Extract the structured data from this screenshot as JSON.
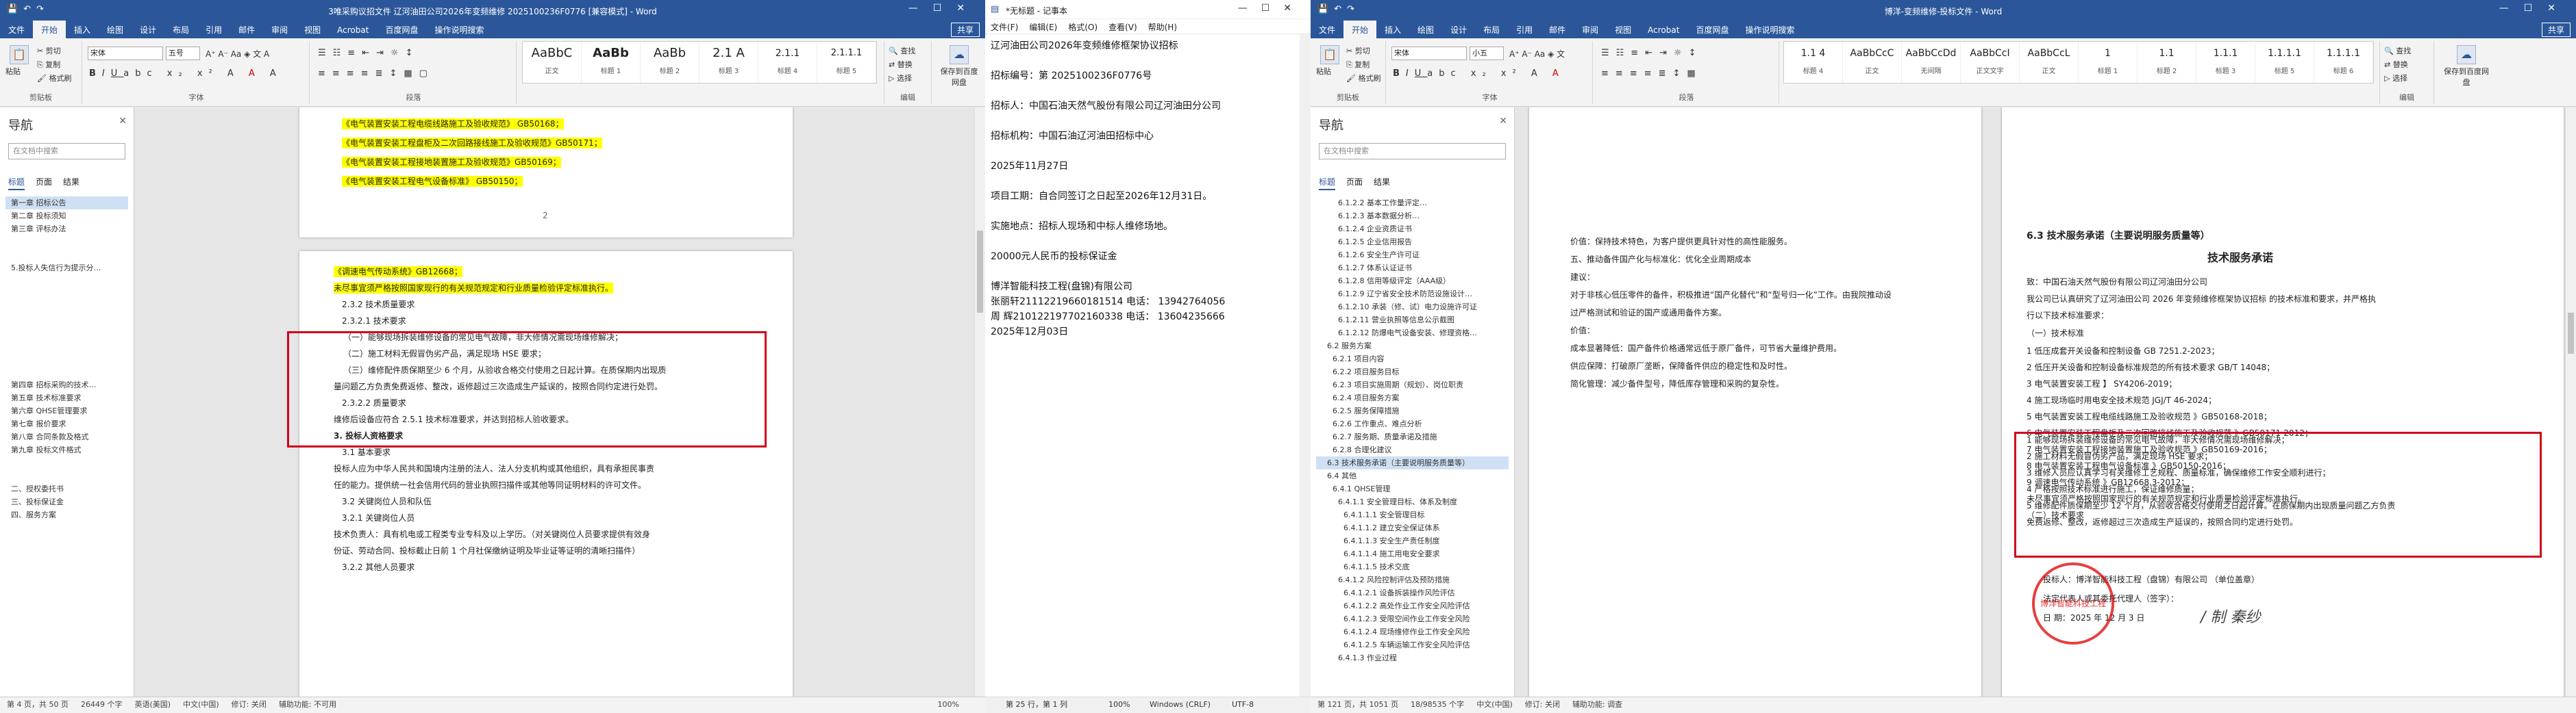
{
  "w1": {
    "title": "3唯采购议招文件 辽河油田公司2026年变频维修 2025100236F0776 [兼容模式] - Word",
    "tabs": [
      "文件",
      "开始",
      "插入",
      "绘图",
      "设计",
      "布局",
      "引用",
      "邮件",
      "审阅",
      "视图",
      "Acrobat",
      "百度网盘"
    ],
    "tell": "操作说明搜索",
    "share": "共享",
    "font": "宋体",
    "size": "五号",
    "groups": [
      "剪贴板",
      "字体",
      "段落",
      "样式",
      "编辑",
      "保存到百度网盘"
    ],
    "clip": [
      "粘贴",
      "剪切",
      "复制",
      "格式刷"
    ],
    "styles": [
      {
        "pv": "AaBbC",
        "nm": "正文"
      },
      {
        "pv": "AaBb",
        "nm": "标题 1"
      },
      {
        "pv": "AaBb",
        "nm": "标题 2"
      },
      {
        "pv": "2.1 A",
        "nm": "标题 3"
      },
      {
        "pv": "2.1.1",
        "nm": "标题 4"
      },
      {
        "pv": "2.1.1.1",
        "nm": "标题 5"
      }
    ],
    "edit": [
      "查找",
      "替换",
      "选择"
    ],
    "nav": {
      "title": "导航",
      "search": "在文档中搜索",
      "tabs": [
        "标题",
        "页面",
        "结果"
      ],
      "items": [
        "第一章 招标公告",
        "第二章 投标须知",
        "第三章 评标办法",
        "",
        "",
        "5.投标人失信行为提示分…",
        "",
        "",
        "",
        "",
        "",
        "",
        "",
        "",
        "第四章 招标采购的技术…",
        "第五章 技术标准要求",
        "第六章 QHSE管理要求",
        "第七章 报价要求",
        "第八章 合同条款及格式",
        "第九章 投标文件格式",
        "",
        "",
        "二、授权委托书",
        "三、投标保证金",
        "四、服务方案"
      ]
    },
    "page1": {
      "lines": [
        "《电气装置安装工程电缆线路施工及验收规范》 GB50168；",
        "《电气装置安装工程盘柜及二次回路接线施工及验收规范》GB50171；",
        "《电气装置安装工程接地装置施工及验收规范》GB50169；",
        "《电气装置安装工程电气设备标准》 GB50150；"
      ],
      "pgnum": "2"
    },
    "page2": {
      "lines": [
        "《调速电气传动系统》GB12668；",
        "未尽事宜须严格按照国家现行的有关规范规定和行业质量检验评定标准执行。",
        "2.3.2 技术质量要求",
        "2.3.2.1 技术要求",
        "（一）能够现场拆装维修设备的常见电气故障，非大修情况需现场维修解决；",
        "（二）施工材料无假冒伪劣产品，满足现场 HSE 要求；",
        "（三）维修配件质保期至少 6 个月，从验收合格交付使用之日起计算。在质保期内出现质",
        "量问题乙方负责免费返修、整改，返修超过三次造成生产延误的，按照合同约定进行处罚。",
        "2.3.2.2 质量要求",
        "维修后设备应符合 2.5.1 技术标准要求，并达到招标人验收要求。",
        "3. 投标人资格要求",
        "3.1 基本要求",
        "投标人应为中华人民共和国境内注册的法人、法人分支机构或其他组织，具有承担民事责",
        "任的能力。提供统一社会信用代码的营业执照扫描件或其他等同证明材料的许可文件。",
        "3.2 关键岗位人员和队伍",
        "3.2.1 关键岗位人员",
        "技术负责人：具有机电或工程类专业专科及以上学历。（对关键岗位人员要求提供有效身",
        "份证、劳动合同、投标截止日前 1 个月社保缴纳证明及毕业证等证明的清晰扫描件）",
        "3.2.2 其他人员要求"
      ]
    },
    "status": [
      "第 4 页，共 50 页",
      "26449 个字",
      "英语(美国)",
      "中文(中国)",
      "修订: 关闭",
      "辅助功能: 不可用"
    ],
    "zoom": "100%"
  },
  "w2": {
    "title": "*无标题 - 记事本",
    "menu": [
      "文件(F)",
      "编辑(E)",
      "格式(O)",
      "查看(V)",
      "帮助(H)"
    ],
    "lines": [
      "辽河油田公司2026年变频维修框架协议招标",
      "",
      "招标编号：第 2025100236F0776号",
      "",
      "招标人：中国石油天然气股份有限公司辽河油田分公司",
      "",
      "招标机构：中国石油辽河油田招标中心",
      "",
      "2025年11月27日",
      "",
      "项目工期：自合同签订之日起至2026年12月31日。",
      "",
      "实施地点：招标人现场和中标人维修场地。",
      "",
      "20000元人民币的投标保证金",
      "",
      "博洋智能科技工程(盘锦)有限公司",
      "张丽轩211122196601815​14    电话：  13942764056",
      "周  辉210122197702160338    电话：  13604235666",
      "2025年12月03日"
    ],
    "status": [
      "第 25 行，第 1 列",
      "100%",
      "Windows (CRLF)",
      "UTF-8"
    ]
  },
  "w3": {
    "title": "博洋-变频维修-投标文件 - Word",
    "tabs": [
      "文件",
      "开始",
      "插入",
      "绘图",
      "设计",
      "布局",
      "引用",
      "邮件",
      "审阅",
      "视图",
      "Acrobat",
      "百度网盘"
    ],
    "tell": "操作说明搜索",
    "share": "共享",
    "font": "宋体",
    "size": "小五",
    "groups": [
      "剪贴板",
      "字体",
      "段落",
      "样式",
      "编辑",
      "保存到百度网盘"
    ],
    "styles": [
      {
        "pv": "1.1 4",
        "nm": "标题 4"
      },
      {
        "pv": "AaBbCcC",
        "nm": "正文"
      },
      {
        "pv": "AaBbCcDd",
        "nm": "无间隔"
      },
      {
        "pv": "AaBbCcI",
        "nm": "正文文字"
      },
      {
        "pv": "AaBbCcL",
        "nm": "正文"
      },
      {
        "pv": "1",
        "nm": "标题 1"
      },
      {
        "pv": "1.1",
        "nm": "标题 2"
      },
      {
        "pv": "1.1.1",
        "nm": "标题 3"
      },
      {
        "pv": "1.1.1.1",
        "nm": "标题 5"
      },
      {
        "pv": "1.1.1.1",
        "nm": "标题 6"
      }
    ],
    "nav": {
      "title": "导航",
      "search": "在文档中搜索",
      "tabs": [
        "标题",
        "页面",
        "结果"
      ],
      "items": [
        "6.1.2.2 基本工作量评定…",
        "6.1.2.3 基本数据分析…",
        "6.1.2.4 企业资质证书",
        "6.1.2.5 企业信用报告",
        "6.1.2.6 安全生产许可证",
        "6.1.2.7 体系认证证书",
        "6.1.2.8 信用等级评定（AAA级）",
        "6.1.2.9 辽宁省安全技术防范设施设计…",
        "6.1.2.10 承装（修、试）电力设施许可证",
        "6.1.2.11 营业执照等信息公示截图",
        "6.1.2.12 防爆电气设备安装、修理资格…",
        "6.2 服务方案",
        "6.2.1 项目内容",
        "6.2.2 项目服务目标",
        "6.2.3 项目实施周期（规划）、岗位职责",
        "6.2.4 项目服务方案",
        "6.2.5 服务保障措施",
        "6.2.6 工作重点、难点分析",
        "6.2.7 服务期、质量承诺及措施",
        "6.2.8 合理化建议",
        "6.3 技术服务承诺（主要说明服务质量等）",
        "6.4 其他",
        "6.4.1 QHSE管理",
        "6.4.1.1 安全管理目标、体系及制度",
        "6.4.1.1.1 安全管理目标",
        "6.4.1.1.2 建立安全保证体系",
        "6.4.1.1.3 安全生产责任制度",
        "6.4.1.1.4 施工用电安全要求",
        "6.4.1.1.5 技术交底",
        "6.4.1.2 风险控制评估及预防措施",
        "6.4.1.2.1 设备拆装操作风险评估",
        "6.4.1.2.2 高处作业工作安全风险评估",
        "6.4.1.2.3 受限空间作业工作安全风险",
        "6.4.1.2.4 现场维修作业工作安全风险",
        "6.4.1.2.5 车辆运输工作安全风险评估",
        "6.4.1.3 作业过程"
      ],
      "selected": 20
    },
    "pageL": {
      "lines": [
        "价值：保持技术特色，为客户提供更具针对性的高性能服务。",
        "五、推动备件国产化与标准化：优化全业周期成本",
        "建议：",
        "对于非核心低压零件的备件，积极推进“国产化替代”和“型号归一化”工作。由我院推动设",
        "过严格测试和验证的国产或通用备件方案。",
        "价值：",
        "成本显著降低：国产备件价格通常远低于原厂备件，可节省大量维护费用。",
        "供应保障：打破原厂垄断，保障备件供应的稳定性和及时性。",
        "简化管理：减少备件型号，降低库存管理和采购的复杂性。"
      ]
    },
    "pageR": {
      "lines": [
        "6.3  技术服务承诺（主要说明服务质量等）",
        "技术服务承诺",
        "致：中国石油天然气股份有限公司辽河油田分公司",
        "我公司已认真研究了辽河油田公司 2026 年变频维修框架协议招标 的技术标准和要求，并严格执",
        "行以下技术标准要求：",
        "（一）技术标准",
        "1 低压成套开关设备和控制设备 GB 7251.2-2023；",
        "2 低压开关设备和控制设备标准规范的所有技术要求 GB/T 14048；",
        "3 电气装置安装工程 】 SY4206-2019；",
        "4 施工现场临时用电安全技术规范  JGJ/T 46-2024；",
        "5 电气装置安装工程电缆线路施工及验收规范 》GB50168-2018；",
        "6 电气装置安装工程盘柜及二次回路接线施工及验收规范 》GB50171-2012；",
        "7 电气装置安装工程接地装置施工及验收规范 》GB50169-2016；",
        "8 电气装置安装工程电气设备标准 》GB50150-2016；",
        "9 调速电气传动系统 》GB12668.3-2012；",
        "未尽事宜须严格按照国家现行的有关规范规定和行业质量检验评定标准执行。",
        "（二）技术要求",
        "1 能够现场拆装维修设备的常见电气故障，非大修情况需现场维修解决；",
        "2 施工材料无假冒伪劣产品，满足现场 HSE 要求；",
        "3 维修人员应认真学习有关维修工艺规程、质量标准，确保维修工作安全顺利进行；",
        "4 严格按照技术标准进行施工，保证维修质量；",
        "5 维修配件质保期至少 12 个月，从验收合格交付使用之日起计算。在质保期内出现质量问题乙方负责",
        "免费返修、整改，返修超过三次造成生产延误的，按照合同约定进行处罚。",
        "",
        "投标人：博洋智能科技工程（盘锦）有限公司  （单位盖章）",
        "法定代表人或其委托代理人（签字）：",
        "日 期：2025 年 12 月 3 日"
      ],
      "seal": "博洋智能科技工程"
    },
    "status": [
      "第 121 页，共 1051 页",
      "18/98535 个字",
      "中文(中国)",
      "修订: 关闭",
      "辅助功能: 调查"
    ]
  }
}
